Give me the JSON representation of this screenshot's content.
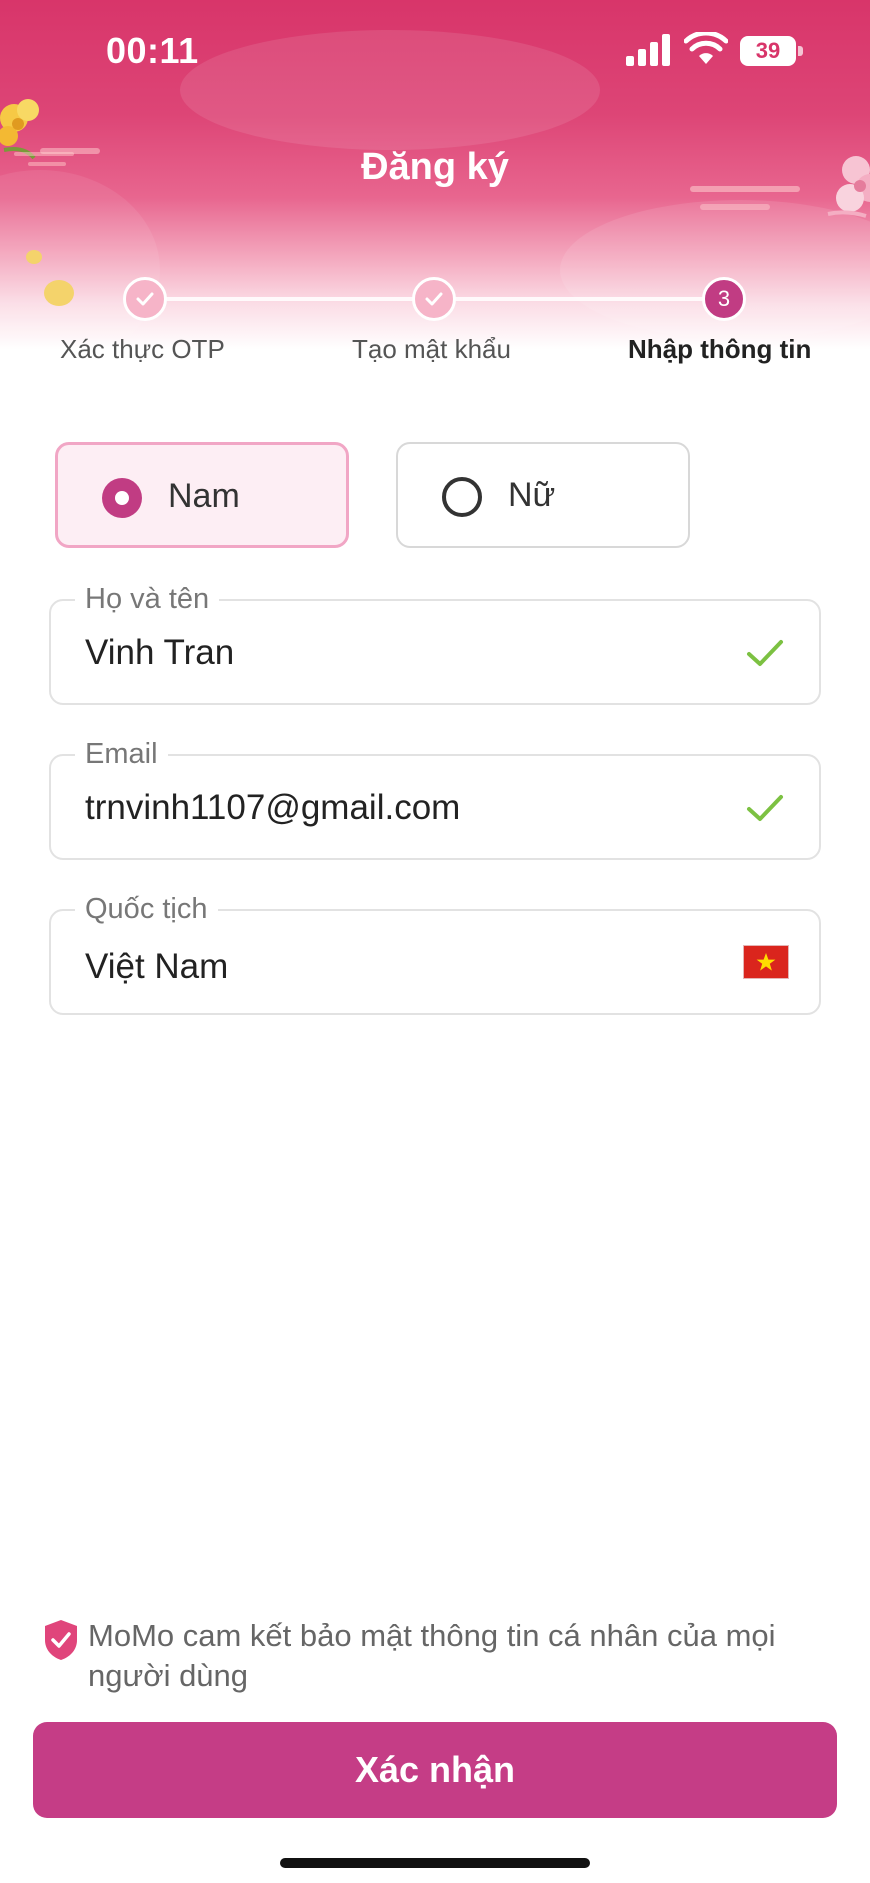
{
  "status_bar": {
    "time": "00:11",
    "battery": "39"
  },
  "header": {
    "title": "Đăng ký"
  },
  "steps": [
    {
      "label": "Xác thực OTP",
      "state": "done"
    },
    {
      "label": "Tạo mật khẩu",
      "state": "done"
    },
    {
      "label": "Nhập thông tin",
      "state": "active",
      "number": "3"
    }
  ],
  "gender": {
    "options": [
      {
        "label": "Nam",
        "selected": true
      },
      {
        "label": "Nữ",
        "selected": false
      }
    ]
  },
  "fields": {
    "name": {
      "label": "Họ và tên",
      "value": "Vinh Tran"
    },
    "email": {
      "label": "Email",
      "value": "trnvinh1107@gmail.com"
    },
    "nationality": {
      "label": "Quốc tịch",
      "value": "Việt Nam"
    }
  },
  "privacy": {
    "text": "MoMo cam kết bảo mật thông tin cá nhân của mọi người dùng"
  },
  "confirm": {
    "label": "Xác nhận"
  },
  "colors": {
    "brand": "#c53d86",
    "header": "#d8356a",
    "check": "#7cc142"
  },
  "icons": {
    "step_done": "check-icon",
    "field_valid": "check-icon",
    "nationality": "vietnam-flag-icon",
    "privacy": "shield-check-icon"
  }
}
